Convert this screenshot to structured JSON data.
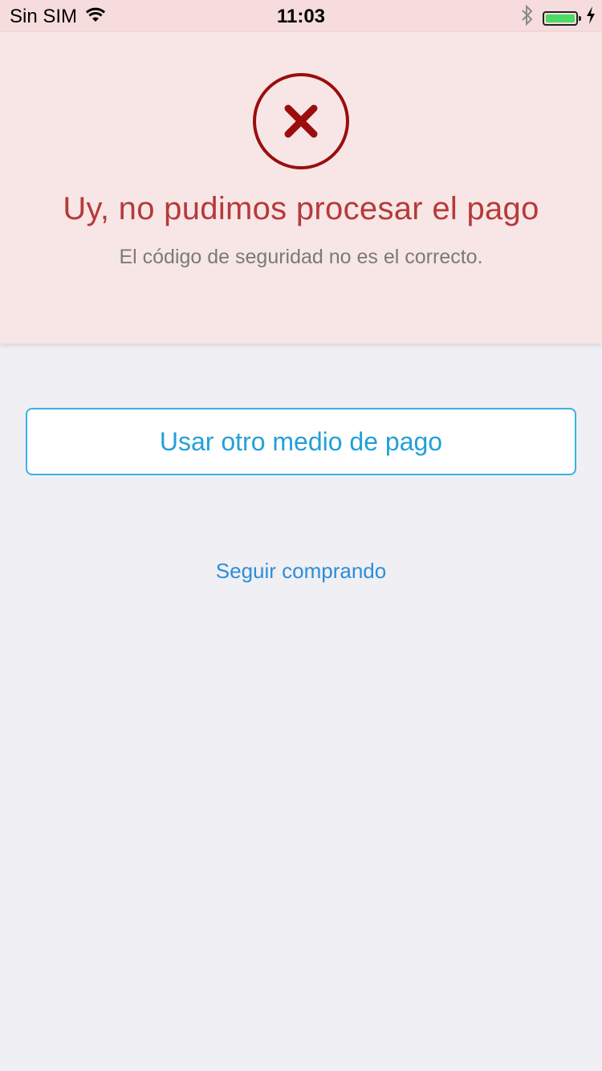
{
  "status_bar": {
    "carrier": "Sin SIM",
    "time": "11:03",
    "wifi_icon": "wifi-icon",
    "bluetooth_icon": "bluetooth-icon",
    "battery_icon": "battery-charging-icon",
    "battery_level": 1.0
  },
  "error": {
    "icon": "close-icon",
    "title": "Uy, no pudimos procesar el pago",
    "subtitle": "El código de seguridad no es el correcto.",
    "colors": {
      "banner_background": "#f8e6e6",
      "icon": "#9a0e0e",
      "title": "#b53a3a"
    }
  },
  "actions": {
    "primary_label": "Usar otro medio de pago",
    "secondary_label": "Seguir comprando",
    "colors": {
      "primary_border": "#3ab2e6",
      "primary_text": "#22a0d8",
      "link": "#2c8ed8"
    }
  }
}
